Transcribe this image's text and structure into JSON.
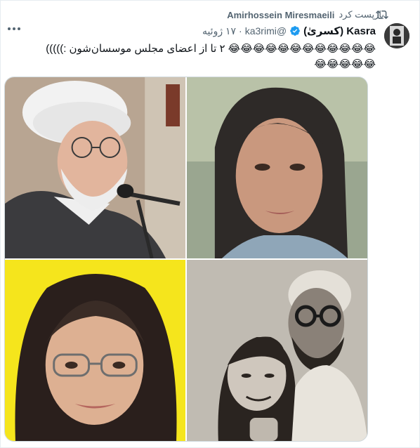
{
  "retweet": {
    "user": "Amirhossein Miresmaeili",
    "label": "بازپست کرد",
    "icon": "retweet-icon"
  },
  "tweet": {
    "display_name": "Kasra (کسریٰ)",
    "verified": true,
    "handle": "@ka3rimi",
    "separator": "·",
    "date": "۱۷ ژوئیه",
    "text": "۲ تا از اعضای مجلس موسسان‌شون :)))))",
    "emoji_line_1": "😂😂😂😂😂😂😂😂😂😂😂😂",
    "emoji_line_2": "😂😂😂😂😂"
  },
  "icons": {
    "more": "more-options-icon",
    "verified": "verified-badge-icon",
    "avatar": "user-avatar"
  },
  "media": {
    "count": 4,
    "photos": [
      "photo-top-left",
      "photo-top-right",
      "photo-bottom-left",
      "photo-bottom-right"
    ]
  },
  "colors": {
    "verified_blue": "#1d9bf0",
    "secondary_text": "#536471",
    "bottom_left_background": "#f5e51c"
  }
}
